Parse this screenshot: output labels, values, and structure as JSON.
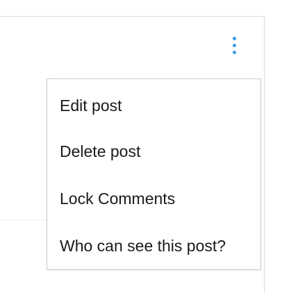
{
  "post_menu": {
    "icon": "more-vertical-icon",
    "accent_color": "#3a9be6",
    "items": [
      {
        "label": "Edit post"
      },
      {
        "label": "Delete post"
      },
      {
        "label": "Lock Comments"
      },
      {
        "label": "Who can see this post?"
      }
    ]
  }
}
